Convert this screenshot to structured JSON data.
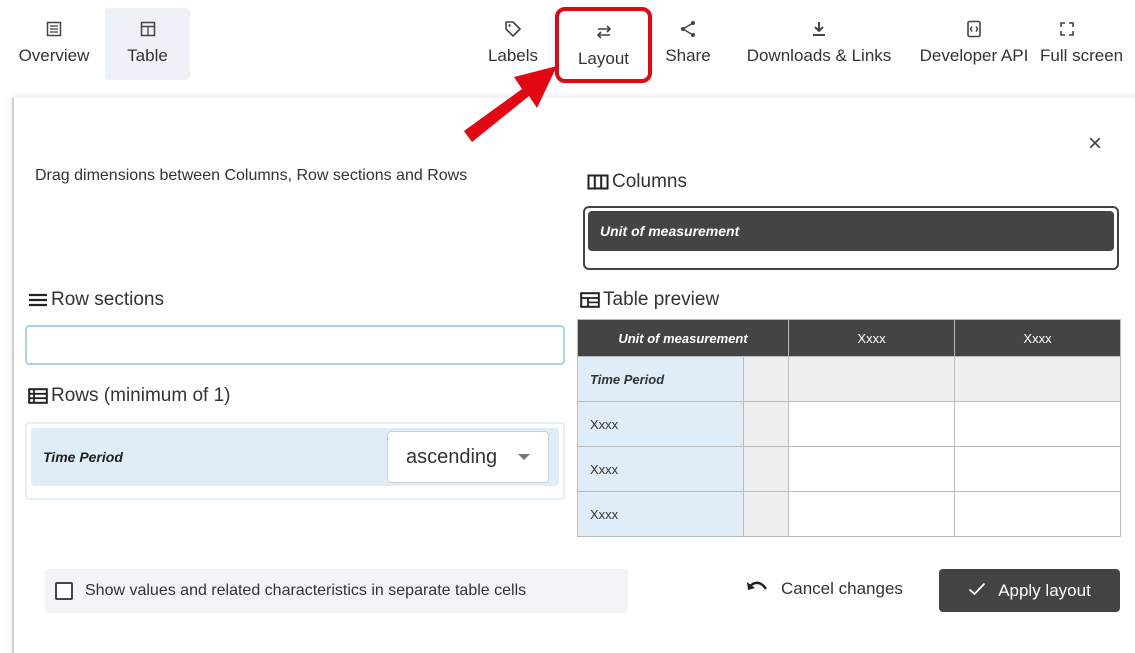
{
  "toolbar": {
    "overview": "Overview",
    "table": "Table",
    "labels": "Labels",
    "layout": "Layout",
    "share": "Share",
    "downloads": "Downloads & Links",
    "developer_api": "Developer API",
    "full_screen": "Full screen"
  },
  "dialog": {
    "close": "×",
    "hint": "Drag dimensions between Columns, Row sections and Rows",
    "columns_title": "Columns",
    "columns_items": [
      "Unit of measurement"
    ],
    "row_sections_title": "Row sections",
    "rows_title": "Rows (minimum of 1)",
    "rows_items": [
      {
        "name": "Time Period",
        "sort": "ascending"
      }
    ],
    "preview_title": "Table preview",
    "preview": {
      "header": [
        "Unit of measurement",
        "Xxxx",
        "Xxxx"
      ],
      "row_dimension": "Time Period",
      "row_labels": [
        "Xxxx",
        "Xxxx",
        "Xxxx"
      ]
    },
    "checkbox_label": "Show values and related characteristics in separate table cells",
    "cancel_label": "Cancel changes",
    "apply_label": "Apply layout"
  },
  "colors": {
    "highlight": "#e30613",
    "dark_chip": "#444444",
    "row_chip": "#deedf8"
  }
}
